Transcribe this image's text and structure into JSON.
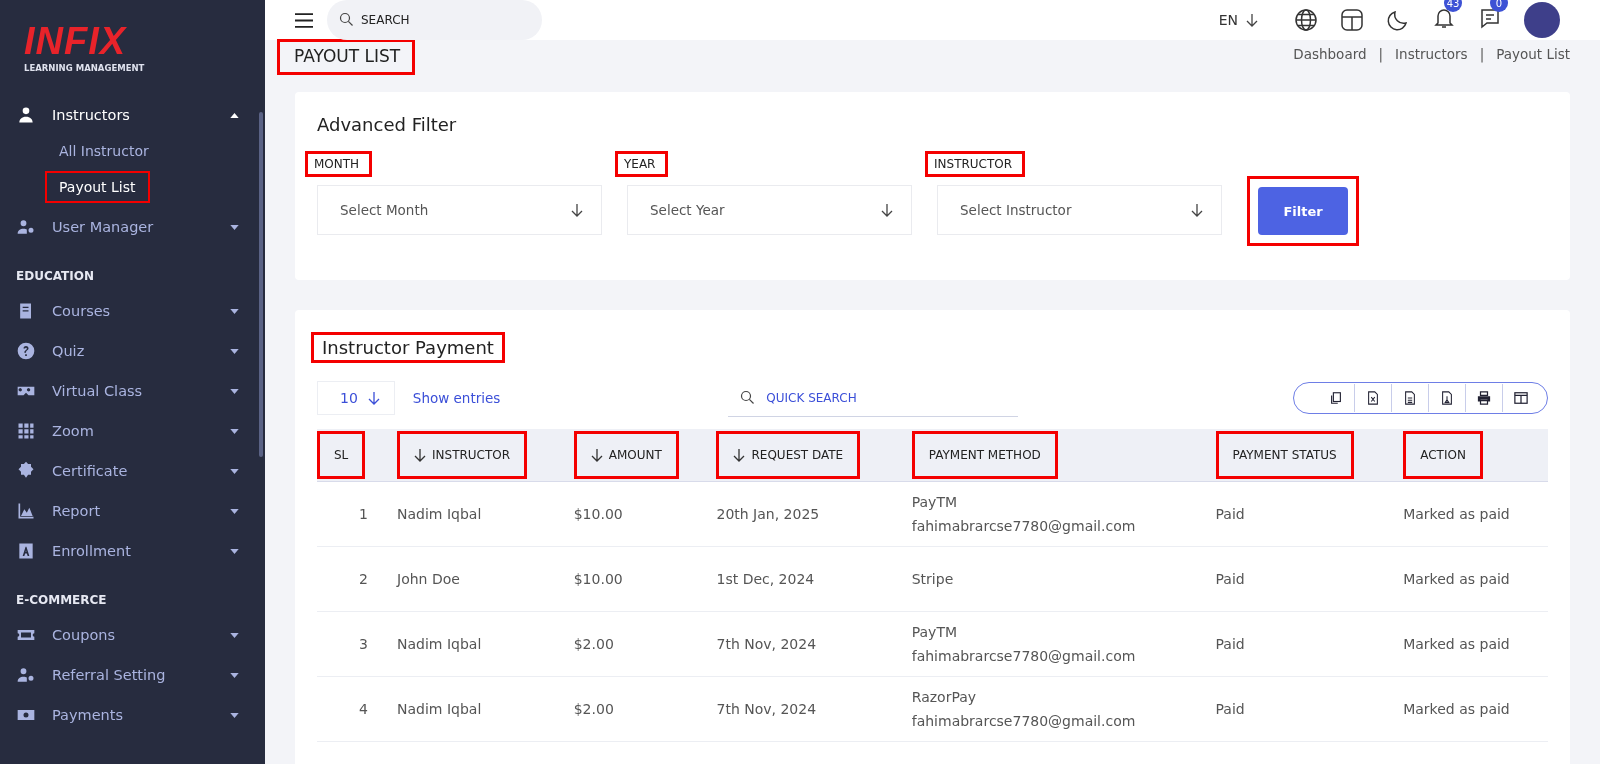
{
  "logo": {
    "name": "INFIX",
    "tagline": "LEARNING MANAGEMENT"
  },
  "sidebar": {
    "sections": [
      {
        "items": [
          {
            "label": "Instructors",
            "expanded": true,
            "children": [
              {
                "label": "All Instructor",
                "selected": false,
                "highlighted": false
              },
              {
                "label": "Payout List",
                "selected": true,
                "highlighted": true
              }
            ]
          },
          {
            "label": "User Manager",
            "expanded": false
          }
        ]
      },
      {
        "heading": "EDUCATION",
        "items": [
          {
            "label": "Courses",
            "expanded": false
          },
          {
            "label": "Quiz",
            "expanded": false
          },
          {
            "label": "Virtual Class",
            "expanded": false
          },
          {
            "label": "Zoom",
            "expanded": false
          },
          {
            "label": "Certificate",
            "expanded": false
          },
          {
            "label": "Report",
            "expanded": false
          },
          {
            "label": "Enrollment",
            "expanded": false
          }
        ]
      },
      {
        "heading": "E-COMMERCE",
        "items": [
          {
            "label": "Coupons",
            "expanded": false
          },
          {
            "label": "Referral Setting",
            "expanded": false
          },
          {
            "label": "Payments",
            "expanded": false
          }
        ]
      }
    ]
  },
  "topbar": {
    "search": {
      "placeholder": "SEARCH"
    },
    "language": "EN",
    "notifications": "43",
    "messages": "0"
  },
  "page_title": {
    "text": "PAYOUT LIST",
    "highlighted": true
  },
  "breadcrumb": {
    "items": [
      "Dashboard",
      "Instructors",
      "Payout List"
    ],
    "separators": [
      "|",
      "|"
    ]
  },
  "filter": {
    "title": "Advanced Filter",
    "fields": [
      {
        "label": "MONTH",
        "placeholder": "Select Month",
        "highlighted": true
      },
      {
        "label": "YEAR",
        "placeholder": "Select Year",
        "highlighted": true
      },
      {
        "label": "INSTRUCTOR",
        "placeholder": "Select Instructor",
        "highlighted": true
      }
    ],
    "button": {
      "label": "Filter",
      "highlighted": true
    }
  },
  "payments": {
    "title": "Instructor Payment",
    "title_highlighted": true,
    "page_size": "10",
    "show_entries": "Show entries",
    "quick_search": {
      "placeholder": "QUICK SEARCH"
    },
    "columns": [
      {
        "label": "SL",
        "sortable": false,
        "highlighted": true
      },
      {
        "label": "INSTRUCTOR",
        "sortable": true,
        "highlighted": true
      },
      {
        "label": "AMOUNT",
        "sortable": true,
        "highlighted": true
      },
      {
        "label": "REQUEST DATE",
        "sortable": true,
        "highlighted": true
      },
      {
        "label": "PAYMENT METHOD",
        "sortable": false,
        "highlighted": true
      },
      {
        "label": "PAYMENT STATUS",
        "sortable": false,
        "highlighted": true
      },
      {
        "label": "ACTION",
        "sortable": false,
        "highlighted": true
      }
    ],
    "rows": [
      {
        "sl": "1",
        "instructor": "Nadim Iqbal",
        "amount": "$10.00",
        "date": "20th Jan, 2025",
        "method": [
          "PayTM",
          "fahimabrarcse7780@gmail.com"
        ],
        "status": "Paid",
        "action": "Marked as paid"
      },
      {
        "sl": "2",
        "instructor": "John Doe",
        "amount": "$10.00",
        "date": "1st Dec, 2024",
        "method": [
          "Stripe"
        ],
        "status": "Paid",
        "action": "Marked as paid"
      },
      {
        "sl": "3",
        "instructor": "Nadim Iqbal",
        "amount": "$2.00",
        "date": "7th Nov, 2024",
        "method": [
          "PayTM",
          "fahimabrarcse7780@gmail.com"
        ],
        "status": "Paid",
        "action": "Marked as paid"
      },
      {
        "sl": "4",
        "instructor": "Nadim Iqbal",
        "amount": "$2.00",
        "date": "7th Nov, 2024",
        "method": [
          "RazorPay",
          "fahimabrarcse7780@gmail.com"
        ],
        "status": "Paid",
        "action": "Marked as paid"
      }
    ]
  }
}
